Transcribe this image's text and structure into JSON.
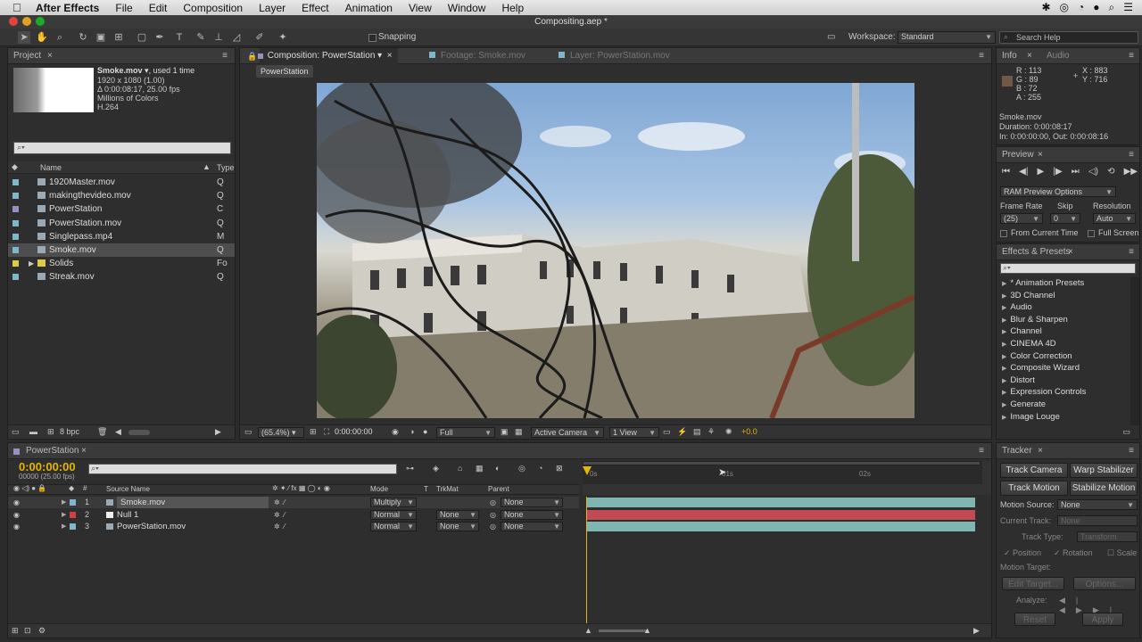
{
  "menubar": {
    "app_name": "After Effects",
    "items": [
      "File",
      "Edit",
      "Composition",
      "Layer",
      "Effect",
      "Animation",
      "View",
      "Window",
      "Help"
    ]
  },
  "window_title": "Compositing.aep *",
  "toolbar": {
    "snapping_label": "Snapping",
    "workspace_label": "Workspace:",
    "workspace_value": "Standard",
    "search_placeholder": "Search Help"
  },
  "project": {
    "tab_label": "Project",
    "selected_name": "Smoke.mov",
    "used_info": ", used 1 time",
    "resolution": "1920 x 1080 (1.00)",
    "duration": "Δ 0:00:08:17, 25.00 fps",
    "colors": "Millions of Colors",
    "codec": "H.264",
    "col_name": "Name",
    "col_type": "Type",
    "items": [
      {
        "name": "1920Master.mov",
        "type": "Q",
        "color": "#7fb6c9"
      },
      {
        "name": "makingthevideo.mov",
        "type": "Q",
        "color": "#7fb6c9"
      },
      {
        "name": "PowerStation",
        "type": "C",
        "color": "#9c8ec2"
      },
      {
        "name": "PowerStation.mov",
        "type": "Q",
        "color": "#7fb6c9"
      },
      {
        "name": "Singlepass.mp4",
        "type": "M",
        "color": "#7fb6c9"
      },
      {
        "name": "Smoke.mov",
        "type": "Q",
        "color": "#7fb6c9"
      },
      {
        "name": "Solids",
        "type": "Fo",
        "color": "#e0c84a"
      },
      {
        "name": "Streak.mov",
        "type": "Q",
        "color": "#7fb6c9"
      }
    ],
    "bpc": "8 bpc"
  },
  "viewer": {
    "tabs": [
      "Composition: PowerStation",
      "Footage: Smoke.mov",
      "Layer: PowerStation.mov"
    ],
    "flow_label": "PowerStation",
    "zoom": "(65.4%)",
    "timecode": "0:00:00:00",
    "resolution": "Full",
    "camera": "Active Camera",
    "views": "1 View",
    "exposure": "+0.0"
  },
  "info": {
    "tab_info": "Info",
    "tab_audio": "Audio",
    "r": "R : 113",
    "g": "G : 89",
    "b": "B : 72",
    "a": "A : 255",
    "x": "X : 883",
    "y": "Y : 716",
    "name": "Smoke.mov",
    "duration": "Duration: 0:00:08:17",
    "inout": "In: 0:00:00:00, Out: 0:00:08:16"
  },
  "preview": {
    "tab_label": "Preview",
    "ram_options": "RAM Preview Options",
    "frame_rate_label": "Frame Rate",
    "skip_label": "Skip",
    "resolution_label": "Resolution",
    "frame_rate_value": "(25)",
    "skip_value": "0",
    "resolution_value": "Auto",
    "from_current": "From Current Time",
    "full_screen": "Full Screen"
  },
  "effects": {
    "tab_label": "Effects & Presets",
    "items": [
      "* Animation Presets",
      "3D Channel",
      "Audio",
      "Blur & Sharpen",
      "Channel",
      "CINEMA 4D",
      "Color Correction",
      "Composite Wizard",
      "Distort",
      "Expression Controls",
      "Generate",
      "Image Louge"
    ]
  },
  "timeline": {
    "tab_label": "PowerStation",
    "timecode": "0:00:00:00",
    "frame_info": "00000 (25.00 fps)",
    "col_source": "Source Name",
    "col_mode": "Mode",
    "col_t": "T",
    "col_trkmat": "TrkMat",
    "col_parent": "Parent",
    "ruler": [
      "0s",
      "01s",
      "02s"
    ],
    "layers": [
      {
        "num": "1",
        "name": "Smoke.mov",
        "mode": "Multiply",
        "trkmat": "",
        "parent": "None",
        "color": "#7fb6c9",
        "bar": "#7fb6b2"
      },
      {
        "num": "2",
        "name": "Null 1",
        "mode": "Normal",
        "trkmat": "None",
        "parent": "None",
        "color": "#d04040",
        "bar": "#c24a52"
      },
      {
        "num": "3",
        "name": "PowerStation.mov",
        "mode": "Normal",
        "trkmat": "None",
        "parent": "None",
        "color": "#7fb6c9",
        "bar": "#7fb6b2"
      }
    ]
  },
  "tracker": {
    "tab_label": "Tracker",
    "track_camera": "Track Camera",
    "warp_stabilizer": "Warp Stabilizer",
    "track_motion": "Track Motion",
    "stabilize_motion": "Stabilize Motion",
    "motion_source_label": "Motion Source:",
    "motion_source_value": "None",
    "current_track_label": "Current Track:",
    "current_track_value": "None",
    "track_type_label": "Track Type:",
    "track_type_value": "Transform",
    "position": "Position",
    "rotation": "Rotation",
    "scale": "Scale",
    "motion_target": "Motion Target:",
    "edit_target": "Edit Target...",
    "options": "Options...",
    "analyze": "Analyze:",
    "reset": "Reset",
    "apply": "Apply"
  }
}
